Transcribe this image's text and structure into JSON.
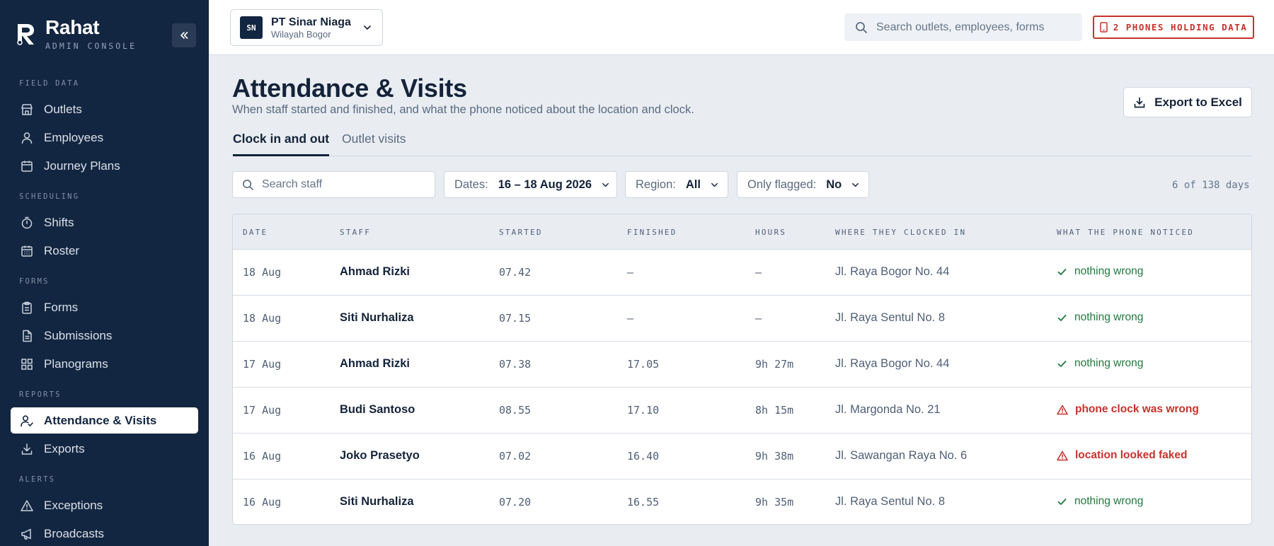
{
  "brand": {
    "name": "Rahat",
    "subtitle": "ADMIN CONSOLE"
  },
  "sidebar": {
    "sections": [
      {
        "label": "FIELD DATA",
        "items": [
          {
            "label": "Outlets",
            "icon": "store-icon"
          },
          {
            "label": "Employees",
            "icon": "user-icon"
          },
          {
            "label": "Journey Plans",
            "icon": "calendar-icon"
          }
        ]
      },
      {
        "label": "SCHEDULING",
        "items": [
          {
            "label": "Shifts",
            "icon": "timer-icon"
          },
          {
            "label": "Roster",
            "icon": "calendar-grid-icon"
          }
        ]
      },
      {
        "label": "FORMS",
        "items": [
          {
            "label": "Forms",
            "icon": "clipboard-icon"
          },
          {
            "label": "Submissions",
            "icon": "document-icon"
          },
          {
            "label": "Planograms",
            "icon": "grid-icon"
          }
        ]
      },
      {
        "label": "REPORTS",
        "items": [
          {
            "label": "Attendance & Visits",
            "icon": "user-check-icon",
            "active": true
          },
          {
            "label": "Exports",
            "icon": "download-icon"
          }
        ]
      },
      {
        "label": "ALERTS",
        "items": [
          {
            "label": "Exceptions",
            "icon": "warning-icon"
          },
          {
            "label": "Broadcasts",
            "icon": "megaphone-icon"
          }
        ]
      }
    ]
  },
  "topbar": {
    "org": {
      "initials": "SN",
      "name": "PT Sinar Niaga",
      "region": "Wilayah Bogor"
    },
    "search_placeholder": "Search outlets, employees, forms",
    "phones_badge": "2 PHONES HOLDING DATA"
  },
  "page": {
    "title": "Attendance & Visits",
    "subtitle": "When staff started and finished, and what the phone noticed about the location and clock.",
    "export_label": "Export to Excel",
    "tabs": [
      {
        "label": "Clock in and out",
        "active": true
      },
      {
        "label": "Outlet visits",
        "active": false
      }
    ]
  },
  "filters": {
    "search_placeholder": "Search staff",
    "dates": {
      "label": "Dates:",
      "value": "16 – 18 Aug 2026"
    },
    "region": {
      "label": "Region:",
      "value": "All"
    },
    "flagged": {
      "label": "Only flagged:",
      "value": "No"
    },
    "count": "6 of 138 days"
  },
  "table": {
    "headers": [
      "DATE",
      "STAFF",
      "STARTED",
      "FINISHED",
      "HOURS",
      "WHERE THEY CLOCKED IN",
      "WHAT THE PHONE NOTICED"
    ],
    "rows": [
      {
        "date": "18 Aug",
        "staff": "Ahmad Rizki",
        "started": "07.42",
        "finished": "—",
        "hours": "—",
        "place": "Jl. Raya Bogor No. 44",
        "noticed": "nothing wrong",
        "status": "ok"
      },
      {
        "date": "18 Aug",
        "staff": "Siti Nurhaliza",
        "started": "07.15",
        "finished": "—",
        "hours": "—",
        "place": "Jl. Raya Sentul No. 8",
        "noticed": "nothing wrong",
        "status": "ok"
      },
      {
        "date": "17 Aug",
        "staff": "Ahmad Rizki",
        "started": "07.38",
        "finished": "17.05",
        "hours": "9h 27m",
        "place": "Jl. Raya Bogor No. 44",
        "noticed": "nothing wrong",
        "status": "ok"
      },
      {
        "date": "17 Aug",
        "staff": "Budi Santoso",
        "started": "08.55",
        "finished": "17.10",
        "hours": "8h 15m",
        "place": "Jl. Margonda No. 21",
        "noticed": "phone clock was wrong",
        "status": "bad"
      },
      {
        "date": "16 Aug",
        "staff": "Joko Prasetyo",
        "started": "07.02",
        "finished": "16.40",
        "hours": "9h 38m",
        "place": "Jl. Sawangan Raya No. 6",
        "noticed": "location looked faked",
        "status": "bad"
      },
      {
        "date": "16 Aug",
        "staff": "Siti Nurhaliza",
        "started": "07.20",
        "finished": "16.55",
        "hours": "9h 35m",
        "place": "Jl. Raya Sentul No. 8",
        "noticed": "nothing wrong",
        "status": "ok"
      }
    ]
  },
  "colors": {
    "sidebar": "#132641",
    "ok": "#1f7a3f",
    "alert": "#c8322c"
  }
}
